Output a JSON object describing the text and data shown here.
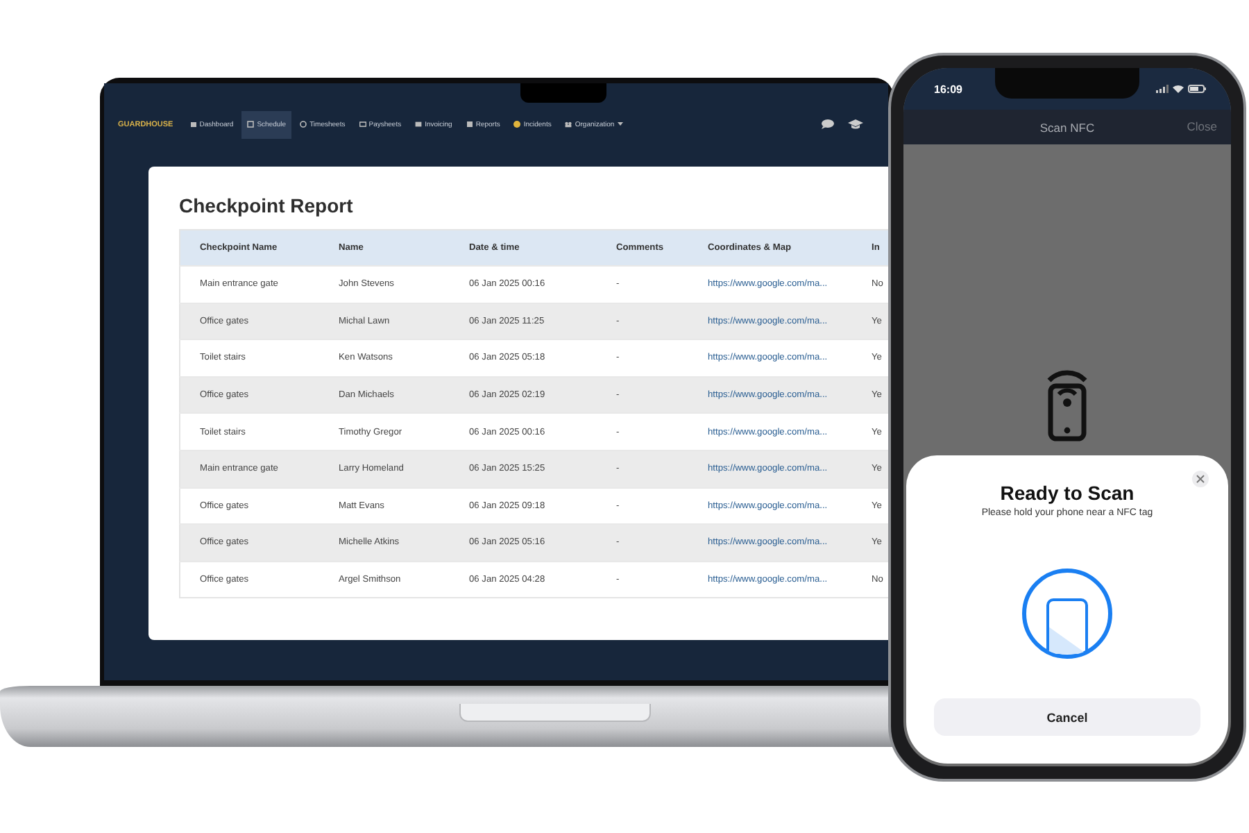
{
  "laptop": {
    "navbar": {
      "brand": "GUARDHOUSE",
      "items": [
        {
          "label": "Dashboard",
          "selected": false,
          "dropdown": false
        },
        {
          "label": "Schedule",
          "selected": true,
          "dropdown": false
        },
        {
          "label": "Timesheets",
          "selected": false,
          "dropdown": false
        },
        {
          "label": "Paysheets",
          "selected": false,
          "dropdown": false
        },
        {
          "label": "Invoicing",
          "selected": false,
          "dropdown": false
        },
        {
          "label": "Reports",
          "selected": false,
          "dropdown": false
        },
        {
          "label": "Incidents",
          "selected": false,
          "dropdown": false
        },
        {
          "label": "Organization",
          "selected": false,
          "dropdown": true
        }
      ]
    },
    "report": {
      "title": "Checkpoint Report",
      "columns": [
        "Checkpoint Name",
        "Name",
        "Date & time",
        "Comments",
        "Coordinates & Map",
        "In"
      ],
      "rows": [
        [
          "Main entrance gate",
          "John Stevens",
          "06 Jan 2025 00:16",
          "-",
          "https://www.google.com/ma...",
          "No"
        ],
        [
          "Office gates",
          "Michal Lawn",
          "06 Jan 2025 11:25",
          "-",
          "https://www.google.com/ma...",
          "Ye"
        ],
        [
          "Toilet stairs",
          "Ken Watsons",
          "06 Jan 2025 05:18",
          "-",
          "https://www.google.com/ma...",
          "Ye"
        ],
        [
          "Office gates",
          "Dan Michaels",
          "06 Jan 2025 02:19",
          "-",
          "https://www.google.com/ma...",
          "Ye"
        ],
        [
          "Toilet stairs",
          "Timothy Gregor",
          "06 Jan 2025 00:16",
          "-",
          "https://www.google.com/ma...",
          "Ye"
        ],
        [
          "Main entrance gate",
          "Larry Homeland",
          "06 Jan 2025 15:25",
          "-",
          "https://www.google.com/ma...",
          "Ye"
        ],
        [
          "Office gates",
          "Matt Evans",
          "06 Jan 2025 09:18",
          "-",
          "https://www.google.com/ma...",
          "Ye"
        ],
        [
          "Office gates",
          "Michelle Atkins",
          "06 Jan 2025 05:16",
          "-",
          "https://www.google.com/ma...",
          "Ye"
        ],
        [
          "Office gates",
          "Argel Smithson",
          "06 Jan 2025 04:28",
          "-",
          "https://www.google.com/ma...",
          "No"
        ]
      ]
    }
  },
  "phone": {
    "status_bar": {
      "time": "16:09"
    },
    "header": {
      "title": "Scan NFC",
      "action": "Close"
    },
    "sheet": {
      "title": "Ready to Scan",
      "message": "Please hold your phone near a NFC tag",
      "button": "Cancel"
    }
  }
}
